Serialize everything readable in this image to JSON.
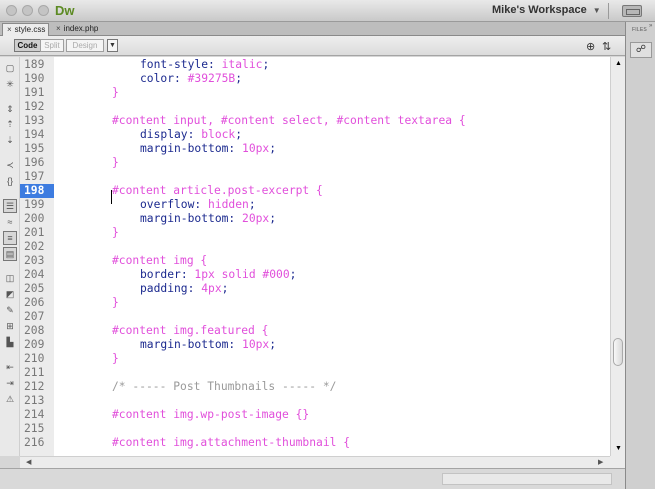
{
  "app": {
    "name": "Dw"
  },
  "workspace": {
    "label": "Mike's Workspace"
  },
  "tabs": [
    {
      "label": "style.css",
      "active": true
    },
    {
      "label": "index.php",
      "active": false
    }
  ],
  "view_modes": {
    "code": "Code",
    "split": "Split",
    "design": "Design",
    "selected": "Code"
  },
  "panel": {
    "label": "FILES"
  },
  "editor": {
    "current_line": 198,
    "scroll_fraction": 0.78,
    "lines": [
      {
        "n": "189",
        "t": [
          [
            "p",
            "font-style"
          ],
          [
            "u",
            ": "
          ],
          [
            "v",
            "italic"
          ],
          [
            "u",
            ";"
          ]
        ],
        "indent": 1
      },
      {
        "n": "190",
        "t": [
          [
            "p",
            "color"
          ],
          [
            "u",
            ": "
          ],
          [
            "v",
            "#39275B"
          ],
          [
            "u",
            ";"
          ]
        ],
        "indent": 1
      },
      {
        "n": "191",
        "t": [
          [
            "s",
            "}"
          ]
        ],
        "indent": 0
      },
      {
        "n": "192",
        "t": [],
        "indent": 0
      },
      {
        "n": "193",
        "t": [
          [
            "s",
            "#content input, #content select, #content textarea {"
          ]
        ],
        "indent": 0
      },
      {
        "n": "194",
        "t": [
          [
            "p",
            "display"
          ],
          [
            "u",
            ": "
          ],
          [
            "v",
            "block"
          ],
          [
            "u",
            ";"
          ]
        ],
        "indent": 1
      },
      {
        "n": "195",
        "t": [
          [
            "p",
            "margin-bottom"
          ],
          [
            "u",
            ": "
          ],
          [
            "v",
            "10px"
          ],
          [
            "u",
            ";"
          ]
        ],
        "indent": 1
      },
      {
        "n": "196",
        "t": [
          [
            "s",
            "}"
          ]
        ],
        "indent": 0
      },
      {
        "n": "197",
        "t": [],
        "indent": 0
      },
      {
        "n": "198",
        "t": [
          [
            "s",
            "#content article.post-excerpt {"
          ]
        ],
        "indent": 0
      },
      {
        "n": "199",
        "t": [
          [
            "p",
            "overflow"
          ],
          [
            "u",
            ": "
          ],
          [
            "v",
            "hidden"
          ],
          [
            "u",
            ";"
          ]
        ],
        "indent": 1
      },
      {
        "n": "200",
        "t": [
          [
            "p",
            "margin-bottom"
          ],
          [
            "u",
            ": "
          ],
          [
            "v",
            "20px"
          ],
          [
            "u",
            ";"
          ]
        ],
        "indent": 1
      },
      {
        "n": "201",
        "t": [
          [
            "s",
            "}"
          ]
        ],
        "indent": 0
      },
      {
        "n": "202",
        "t": [],
        "indent": 0
      },
      {
        "n": "203",
        "t": [
          [
            "s",
            "#content img {"
          ]
        ],
        "indent": 0
      },
      {
        "n": "204",
        "t": [
          [
            "p",
            "border"
          ],
          [
            "u",
            ": "
          ],
          [
            "v",
            "1px solid #000"
          ],
          [
            "u",
            ";"
          ]
        ],
        "indent": 1
      },
      {
        "n": "205",
        "t": [
          [
            "p",
            "padding"
          ],
          [
            "u",
            ": "
          ],
          [
            "v",
            "4px"
          ],
          [
            "u",
            ";"
          ]
        ],
        "indent": 1
      },
      {
        "n": "206",
        "t": [
          [
            "s",
            "}"
          ]
        ],
        "indent": 0
      },
      {
        "n": "207",
        "t": [],
        "indent": 0
      },
      {
        "n": "208",
        "t": [
          [
            "s",
            "#content img.featured {"
          ]
        ],
        "indent": 0
      },
      {
        "n": "209",
        "t": [
          [
            "p",
            "margin-bottom"
          ],
          [
            "u",
            ": "
          ],
          [
            "v",
            "10px"
          ],
          [
            "u",
            ";"
          ]
        ],
        "indent": 1
      },
      {
        "n": "210",
        "t": [
          [
            "s",
            "}"
          ]
        ],
        "indent": 0
      },
      {
        "n": "211",
        "t": [],
        "indent": 0
      },
      {
        "n": "212",
        "t": [
          [
            "c",
            "/* ----- Post Thumbnails ----- */"
          ]
        ],
        "indent": 0
      },
      {
        "n": "213",
        "t": [],
        "indent": 0
      },
      {
        "n": "214",
        "t": [
          [
            "s",
            "#content img.wp-post-image {}"
          ]
        ],
        "indent": 0
      },
      {
        "n": "215",
        "t": [],
        "indent": 0
      },
      {
        "n": "216",
        "t": [
          [
            "s",
            "#content img.attachment-thumbnail {"
          ]
        ],
        "indent": 0
      }
    ]
  },
  "colors": {
    "selector": "#e14fdb",
    "property": "#1c2a8f",
    "value": "#e14fdb",
    "comment": "#9a9a9a",
    "current_line_bg": "#3d7ce0",
    "logo": "#5c8a23"
  },
  "icons": {
    "left_toolbar": [
      "open-documents-icon",
      "collapse-icon",
      "collapse-selection-icon",
      "expand-all-icon",
      "select-parent-icon",
      "balance-braces-icon",
      "line-numbers-icon",
      "highlight-invalid-icon",
      "syntax-coloring-icon",
      "word-wrap-icon",
      "apply-comment-icon",
      "remove-comment-icon",
      "wrap-tag-icon",
      "recent-snippets-icon",
      "move-css-icon",
      "indent-icon",
      "outdent-icon",
      "format-source-icon"
    ]
  }
}
